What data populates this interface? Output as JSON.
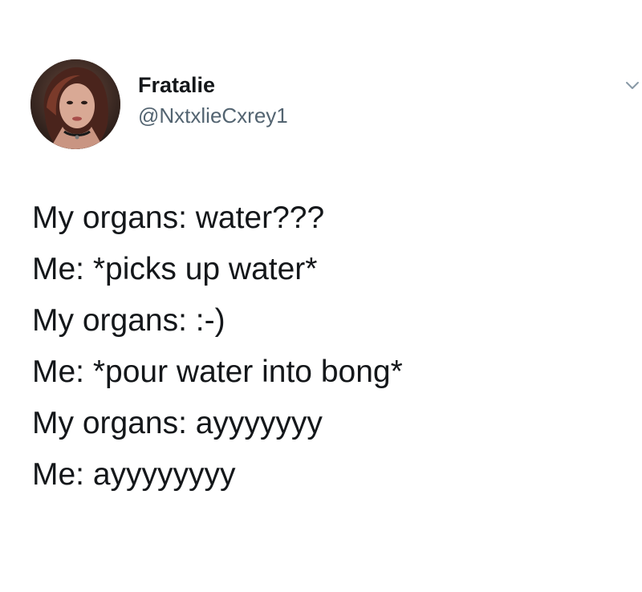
{
  "tweet": {
    "author": {
      "display_name": "Fratalie",
      "handle": "@NxtxlieCxrey1",
      "avatar_icon": "profile-photo"
    },
    "menu_icon": "chevron-down-icon",
    "lines": [
      "My organs: water???",
      "Me: *picks up water*",
      "My organs: :-)",
      "Me: *pour water into bong*",
      "My organs: ayyyyyyy",
      "Me: ayyyyyyyy"
    ]
  },
  "colors": {
    "background": "#ffffff",
    "text_primary": "#14171a",
    "text_secondary": "#536471"
  }
}
